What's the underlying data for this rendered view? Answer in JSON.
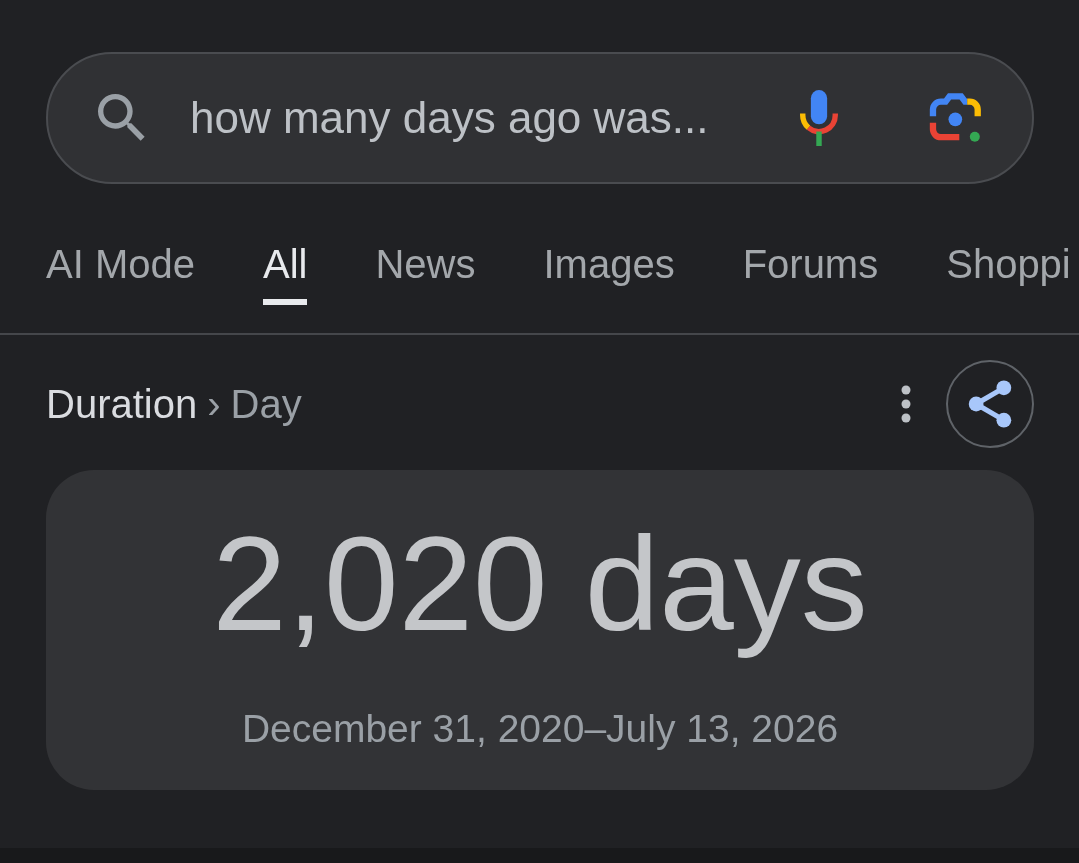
{
  "search": {
    "value": "how many days ago was..."
  },
  "tabs": [
    {
      "label": "AI Mode",
      "selected": false
    },
    {
      "label": "All",
      "selected": true
    },
    {
      "label": "News",
      "selected": false
    },
    {
      "label": "Images",
      "selected": false
    },
    {
      "label": "Forums",
      "selected": false
    },
    {
      "label": "Shoppi",
      "selected": false
    }
  ],
  "breadcrumb": {
    "category": "Duration",
    "separator": "›",
    "unit": "Day"
  },
  "result": {
    "value": "2,020 days",
    "date_range": "December 31, 2020–July 13, 2026"
  }
}
